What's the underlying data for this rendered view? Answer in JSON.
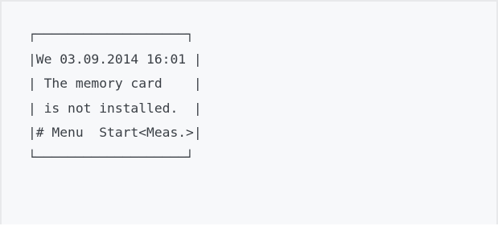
{
  "display": {
    "top_border": "┌───────────────────┐",
    "lines": [
      "|We 03.09.2014 16:01 |",
      "| The memory card    |",
      "| is not installed.  |",
      "|# Menu  Start<Meas.>|"
    ],
    "bottom_border": "└───────────────────┘"
  }
}
